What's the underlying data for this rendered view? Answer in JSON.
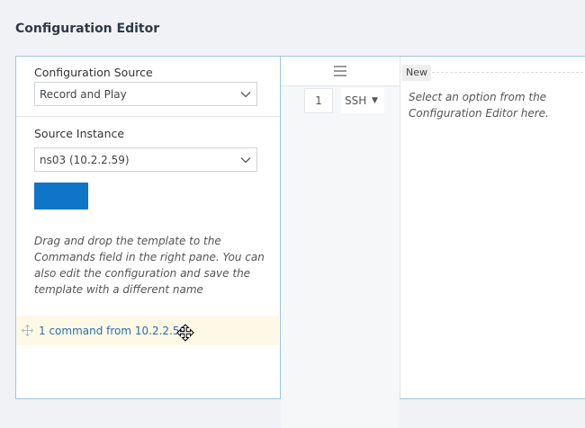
{
  "page": {
    "title": "Configuration Editor"
  },
  "left": {
    "source_label": "Configuration Source",
    "source_value": "Record and Play",
    "instance_label": "Source Instance",
    "instance_value": "ns03 (10.2.2.59)",
    "button_label": "",
    "hint": "Drag and drop the template to the Commands field in the right pane. You can also edit the configuration and save the template with a different name",
    "command_item": "1 command from 10.2.2.59"
  },
  "middle": {
    "line_number": "1",
    "protocol": "SSH"
  },
  "right": {
    "tab_label": "New",
    "hint": "Select an option from the Configurati⁠on Editor here."
  },
  "colors": {
    "accent": "#0e75c7",
    "panel_border": "#9fc4e0",
    "command_highlight": "#fdf9e6",
    "link": "#2a6db0"
  },
  "icons": [
    "chevron-down-icon",
    "move-icon",
    "hamburger-menu-icon",
    "dropdown-caret-icon",
    "drag-cursor-icon"
  ]
}
